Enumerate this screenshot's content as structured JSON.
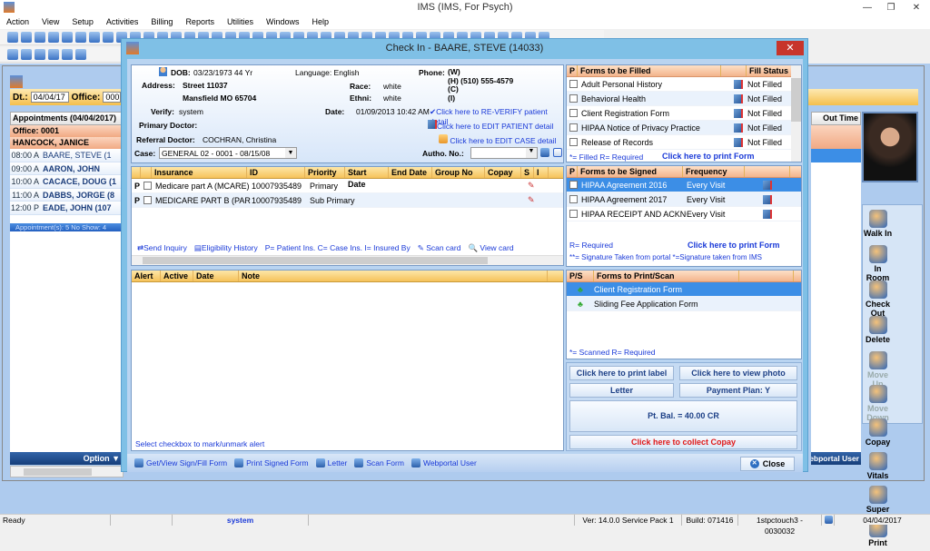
{
  "app": {
    "title": "IMS (IMS, For Psych)",
    "menu": [
      "Action",
      "View",
      "Setup",
      "Activities",
      "Billing",
      "Reports",
      "Utilities",
      "Windows",
      "Help"
    ]
  },
  "schedule": {
    "dt_label": "Dt.:",
    "dt_value": "04/04/17",
    "office_label": "Office:",
    "office_value": "0001",
    "appointments_header": "Appointments (04/04/2017)",
    "office_row": "Office: 0001",
    "provider": "HANCOCK, JANICE",
    "out_time_header": "Out Time",
    "appointments": [
      {
        "time": "08:00 A",
        "name": "BAARE, STEVE (1",
        "current": true
      },
      {
        "time": "09:00 A",
        "name": "AARON, JOHN"
      },
      {
        "time": "10:00 A",
        "name": "CACACE, DOUG (1"
      },
      {
        "time": "11:00 A",
        "name": "DABBS, JORGE (8"
      },
      {
        "time": "12:00 P",
        "name": "EADE, JOHN (107"
      }
    ],
    "summary": "Appointment(s): 5  No Show: 4",
    "option_label": "Option",
    "webportal_label": "Webportal User",
    "side_buttons": [
      "Walk In",
      "In Room",
      "Check Out",
      "Delete",
      "Move Up",
      "Move Down",
      "Copay",
      "Vitals",
      "Super Bill",
      "Print"
    ]
  },
  "dialog": {
    "title": "Check In - BAARE, STEVE  (14033)",
    "close_x": "✕",
    "patient": {
      "dob_label": "DOB:",
      "dob": "03/23/1973  44 Yr",
      "language": "Language: English",
      "phone_label": "Phone:",
      "phones": [
        "(W)",
        "(H)  (510) 555-4579",
        "(C)",
        "(I)"
      ],
      "address_label": "Address:",
      "address1": "Street 11037",
      "address2": "Mansfield  MO  65704",
      "race_label": "Race:",
      "race": "white",
      "ethni_label": "Ethni:",
      "ethni": "white",
      "verify_label": "Verify:",
      "verify": "system",
      "date_label": "Date:",
      "date": "01/09/2013 10:42 AM",
      "reverify_link": "Click here to RE-VERIFY patient detail",
      "primary_doctor_label": "Primary Doctor:",
      "edit_patient_link": "Click here to EDIT PATIENT detail",
      "referral_label": "Referral Doctor:",
      "referral": "COCHRAN, Christina",
      "edit_case_link": "Click here to EDIT CASE detail",
      "case_label": "Case:",
      "case_value": "GENERAL 02  -  0001 - 08/15/08",
      "autho_label": "Autho. No.:",
      "autho_value": ""
    },
    "insurance": {
      "headers": [
        "",
        "",
        "Insurance",
        "ID",
        "Priority",
        "Start Date",
        "End Date",
        "Group No",
        "Copay",
        "S",
        "I"
      ],
      "rows": [
        {
          "p": "P",
          "name": "Medicare part A   (MCARE)",
          "id": "10007935489",
          "priority": "Primary"
        },
        {
          "p": "P",
          "name": "MEDICARE PART B   (PAR",
          "id": "10007935489",
          "priority": "Sub Primary"
        }
      ],
      "send_inquiry": "Send Inquiry",
      "eligibility": "Eligibility History",
      "legend": "P= Patient Ins. C= Case Ins.  I= Insured By",
      "scan_card": "Scan card",
      "view_card": "View card"
    },
    "alerts": {
      "headers": [
        "Alert",
        "Active",
        "Date",
        "Note"
      ],
      "hint": "Select checkbox to mark/unmark alert"
    },
    "forms_filled": {
      "headers": [
        "P",
        "Forms to be Filled",
        "",
        "Fill Status"
      ],
      "rows": [
        {
          "name": "Adult Personal History",
          "status": "Not Filled"
        },
        {
          "name": "Behavioral Health",
          "status": "Not Filled"
        },
        {
          "name": "Client Registration Form",
          "status": "Not Filled"
        },
        {
          "name": "HIPAA Notice of Privacy Practice",
          "status": "Not Filled"
        },
        {
          "name": "Release of Records",
          "status": "Not Filled"
        }
      ],
      "legend": "*= Filled   R= Required",
      "print_link": "Click here to print Form"
    },
    "forms_signed": {
      "headers": [
        "P",
        "Forms to be Signed",
        "Frequency",
        ""
      ],
      "rows": [
        {
          "name": "HIPAA Agreement 2016",
          "freq": "Every Visit",
          "selected": true
        },
        {
          "name": "HIPAA Agreement 2017",
          "freq": "Every Visit"
        },
        {
          "name": "HIPAA RECEIPT AND ACKNO'",
          "freq": "Every Visit"
        }
      ],
      "legend": "R= Required",
      "print_link": "Click here to print Form",
      "legend2": "**= Signature Taken from portal   *=Signature taken from IMS"
    },
    "forms_print": {
      "headers": [
        "P/S",
        "Forms to Print/Scan",
        ""
      ],
      "rows": [
        {
          "name": "Client Registration Form",
          "selected": true
        },
        {
          "name": "Sliding Fee Application Form"
        }
      ],
      "legend": "*= Scanned   R= Required"
    },
    "buttons": {
      "print_label": "Click here to print label",
      "view_photo": "Click here to view photo",
      "letter": "Letter",
      "payment_plan": "Payment Plan: Y",
      "balance": "Pt. Bal. = 40.00 CR",
      "collect_copay": "Click here to collect Copay"
    },
    "bottom": {
      "items": [
        "Get/View Sign/Fill Form",
        "Print Signed Form",
        "Letter",
        "Scan Form",
        "Webportal User"
      ],
      "close": "Close"
    }
  },
  "statusbar": {
    "ready": "Ready",
    "user": "system",
    "version": "Ver: 14.0.0 Service Pack 1",
    "build": "Build: 071416",
    "station": "1stpctouch3 - 0030032",
    "date": "04/04/2017"
  },
  "colors": {
    "accent": "#3c8ee6",
    "header": "#f6c25a",
    "link": "#1a3ad8",
    "copay": "#e01818"
  }
}
